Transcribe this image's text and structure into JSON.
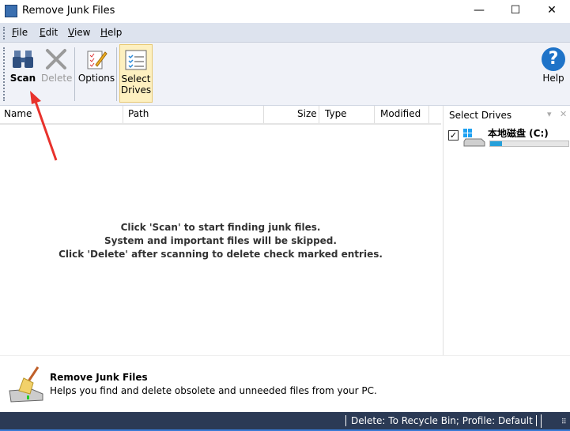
{
  "window": {
    "title": "Remove Junk Files",
    "minimize": "—",
    "maximize": "☐",
    "close": "✕"
  },
  "menu": [
    {
      "label": "File",
      "key": "F",
      "rest": "ile"
    },
    {
      "label": "Edit",
      "key": "E",
      "rest": "dit"
    },
    {
      "label": "View",
      "key": "V",
      "rest": "iew"
    },
    {
      "label": "Help",
      "key": "H",
      "rest": "elp"
    }
  ],
  "toolbar": {
    "scan": "Scan",
    "delete": "Delete",
    "options": "Options",
    "select_drives_1": "Select",
    "select_drives_2": "Drives",
    "help": "Help"
  },
  "list": {
    "columns": [
      "Name",
      "Path",
      "Size",
      "Type",
      "Modified"
    ],
    "hint": [
      "Click 'Scan' to start finding junk files.",
      "System and important files will be skipped.",
      "Click 'Delete' after scanning to delete check marked entries."
    ]
  },
  "drives_panel": {
    "title": "Select Drives",
    "drives": [
      {
        "name": "本地磁盘 (C:)",
        "checked": true,
        "usage_percent": 15
      }
    ]
  },
  "footer": {
    "title": "Remove Junk Files",
    "description": "Helps you find and delete obsolete and unneeded files from your PC."
  },
  "status": {
    "text": "Delete: To Recycle Bin; Profile: Default"
  },
  "colors": {
    "status_bg": "#2b3a55",
    "selected_button": "#fdf0c0",
    "drive_bar": "#26a0da",
    "annotation_arrow": "#e8322c"
  }
}
